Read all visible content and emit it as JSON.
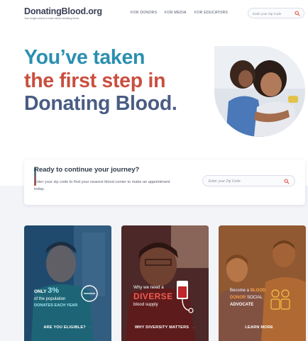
{
  "header": {
    "logo": "DonatingBlood.org",
    "tagline": "Your single source to learn about donating blood",
    "nav": [
      "FOR DONORS",
      "FOR MEDIA",
      "FOR EDUCATORS"
    ],
    "search_placeholder": "Enter your Zip Code"
  },
  "hero": {
    "line1": "You’ve taken",
    "line2": "the first step in",
    "line3": "Donating Blood."
  },
  "journey": {
    "title": "Ready to continue your journey?",
    "description": "Enter your zip code to find your nearest blood center to make an appointment today.",
    "zip_placeholder": "Enter your Zip Code"
  },
  "cards": [
    {
      "stat_prefix": "ONLY",
      "stat_value": "3%",
      "line2": "of the population",
      "line3": "DONATES EACH YEAR",
      "link": "ARE YOU ELIGIBLE?",
      "arrow": "→"
    },
    {
      "line1": "Why we need a",
      "highlight": "DIVERSE",
      "line3": "blood supply",
      "link": "WHY DIVERSITY MATTERS",
      "arrow": "→"
    },
    {
      "line1a": "Become a",
      "line1b": "BLOOD",
      "line2a": "DONOR",
      "line2b": "SOCIAL",
      "line3": "ADVOCATE",
      "link": "LEARN MORE",
      "arrow": "→"
    }
  ],
  "colors": {
    "teal": "#2a8fb0",
    "red": "#c94f3f",
    "navy": "#4a5c83",
    "accent_red": "#e9564a",
    "accent_orange": "#f0a24a"
  }
}
